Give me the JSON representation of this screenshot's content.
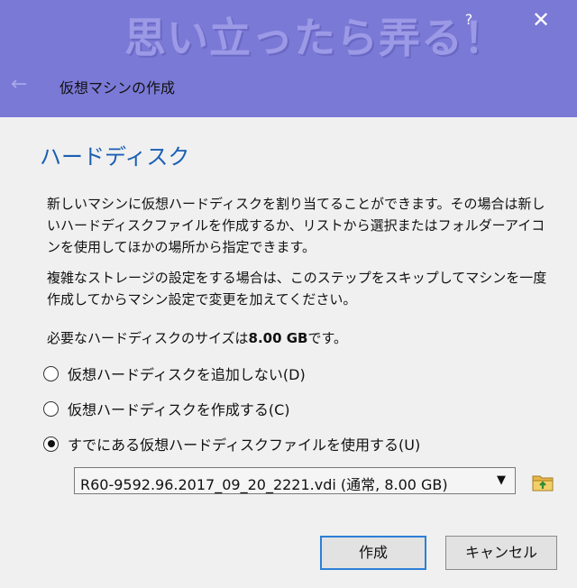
{
  "watermark": "思い立ったら弄る！",
  "titlebar": {
    "help_label": "?",
    "close_label": "✕"
  },
  "wizard": {
    "back_icon": "←",
    "title": "仮想マシンの作成"
  },
  "section_title": "ハードディスク",
  "paragraphs": {
    "p1": "新しいマシンに仮想ハードディスクを割り当てることができます。その場合は新しいハードディスクファイルを作成するか、リストから選択またはフォルダーアイコンを使用してほかの場所から指定できます。",
    "p2": "複雑なストレージの設定をする場合は、このステップをスキップしてマシンを一度作成してからマシン設定で変更を加えてください。",
    "p3_prefix": "必要なハードディスクのサイズは",
    "p3_size": "8.00 GB",
    "p3_suffix": "です。"
  },
  "options": {
    "none": "仮想ハードディスクを追加しない(D)",
    "create": "仮想ハードディスクを作成する(C)",
    "existing": "すでにある仮想ハードディスクファイルを使用する(U)",
    "selected": "existing"
  },
  "disk_select": {
    "value": "R60-9592.96.2017_09_20_2221.vdi (通常, 8.00 GB)"
  },
  "buttons": {
    "create": "作成",
    "cancel": "キャンセル"
  },
  "colors": {
    "titlebar": "#7b79d6",
    "title_blue": "#1a5fb4",
    "content_bg": "#f0f0f0"
  }
}
